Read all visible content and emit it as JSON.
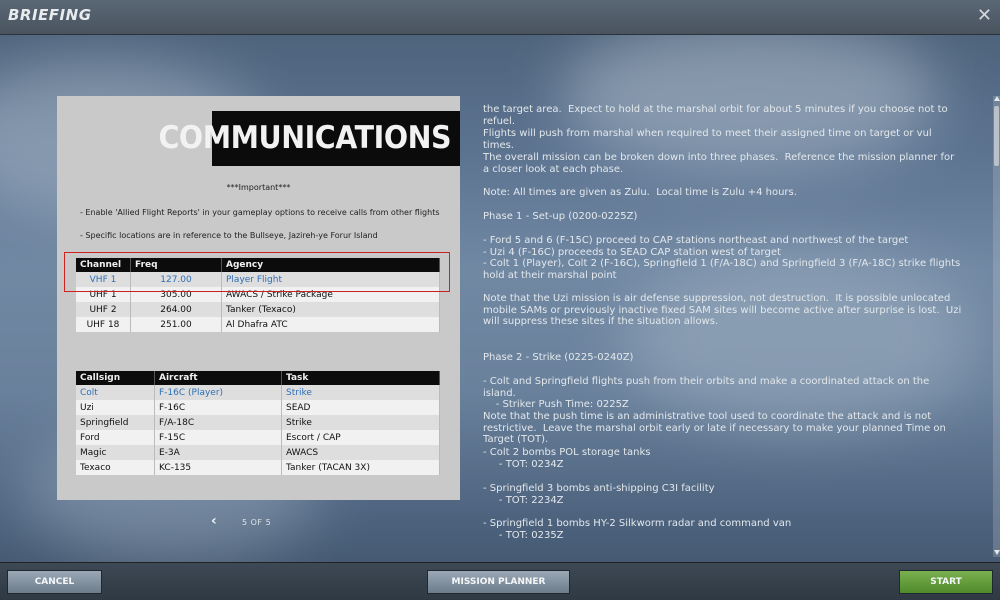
{
  "window": {
    "title": "BRIEFING"
  },
  "slide": {
    "banner_title": "COMMUNICATIONS",
    "important": "***Important***",
    "notes": [
      "- Enable 'Allied Flight Reports' in your gameplay options to receive calls from other flights",
      "- Specific locations are in reference to the Bullseye, Jazireh-ye Forur Island"
    ],
    "comms_table": {
      "headers": [
        "Channel",
        "Freq",
        "Agency"
      ],
      "rows": [
        [
          "VHF 1",
          "127.00",
          "Player Flight"
        ],
        [
          "UHF 1",
          "305.00",
          "AWACS / Strike Package"
        ],
        [
          "UHF 2",
          "264.00",
          "Tanker (Texaco)"
        ],
        [
          "UHF 18",
          "251.00",
          "Al Dhafra ATC"
        ]
      ]
    },
    "flight_table": {
      "headers": [
        "Callsign",
        "Aircraft",
        "Task"
      ],
      "rows": [
        [
          "Colt",
          "F-16C (Player)",
          "Strike"
        ],
        [
          "Uzi",
          "F-16C",
          "SEAD"
        ],
        [
          "Springfield",
          "F/A-18C",
          "Strike"
        ],
        [
          "Ford",
          "F-15C",
          "Escort / CAP"
        ],
        [
          "Magic",
          "E-3A",
          "AWACS"
        ],
        [
          "Texaco",
          "KC-135",
          "Tanker (TACAN 3X)"
        ]
      ]
    }
  },
  "pager": {
    "prev_icon": "chevron-left-icon",
    "label": "5 OF 5"
  },
  "briefing_text": [
    "the target area.  Expect to hold at the marshal orbit for about 5 minutes if you choose not to refuel.",
    "Flights will push from marshal when required to meet their assigned time on target or vul times.",
    "The overall mission can be broken down into three phases.  Reference the mission planner for a closer look at each phase.",
    "Note: All times are given as Zulu.  Local time is Zulu +4 hours.",
    "Phase 1 - Set-up (0200-0225Z)",
    "- Ford 5 and 6 (F-15C) proceed to CAP stations northeast and northwest of the target\n- Uzi 4 (F-16C) proceeds to SEAD CAP station west of target\n- Colt 1 (Player), Colt 2 (F-16C), Springfield 1 (F/A-18C) and Springfield 3 (F/A-18C) strike flights hold at their marshal point",
    "Note that the Uzi mission is air defense suppression, not destruction.  It is possible unlocated mobile SAMs or previously inactive fixed SAM sites will become active after surprise is lost.  Uzi will suppress these sites if the situation allows.",
    "Phase 2 - Strike (0225-0240Z)",
    "- Colt and Springfield flights push from their orbits and make a coordinated attack on the island.\n    - Striker Push Time: 0225Z",
    "Note that the push time is an administrative tool used to coordinate the attack and is not restrictive.  Leave the marshal orbit early or late if necessary to make your planned Time on Target (TOT).",
    "- Colt 2 bombs POL storage tanks\n     - TOT: 0234Z",
    "- Springfield 3 bombs anti-shipping C3I facility\n     - TOT: 2234Z",
    "- Springfield 1 bombs HY-2 Silkworm radar and command van\n     - TOT: 0235Z"
  ],
  "footer": {
    "cancel_label": "CANCEL",
    "mission_planner_label": "MISSION PLANNER",
    "start_label": "START"
  },
  "colors": {
    "highlight_border": "#cc2222",
    "link_blue": "#2f6fb5",
    "start_green": "#5f9a36"
  }
}
